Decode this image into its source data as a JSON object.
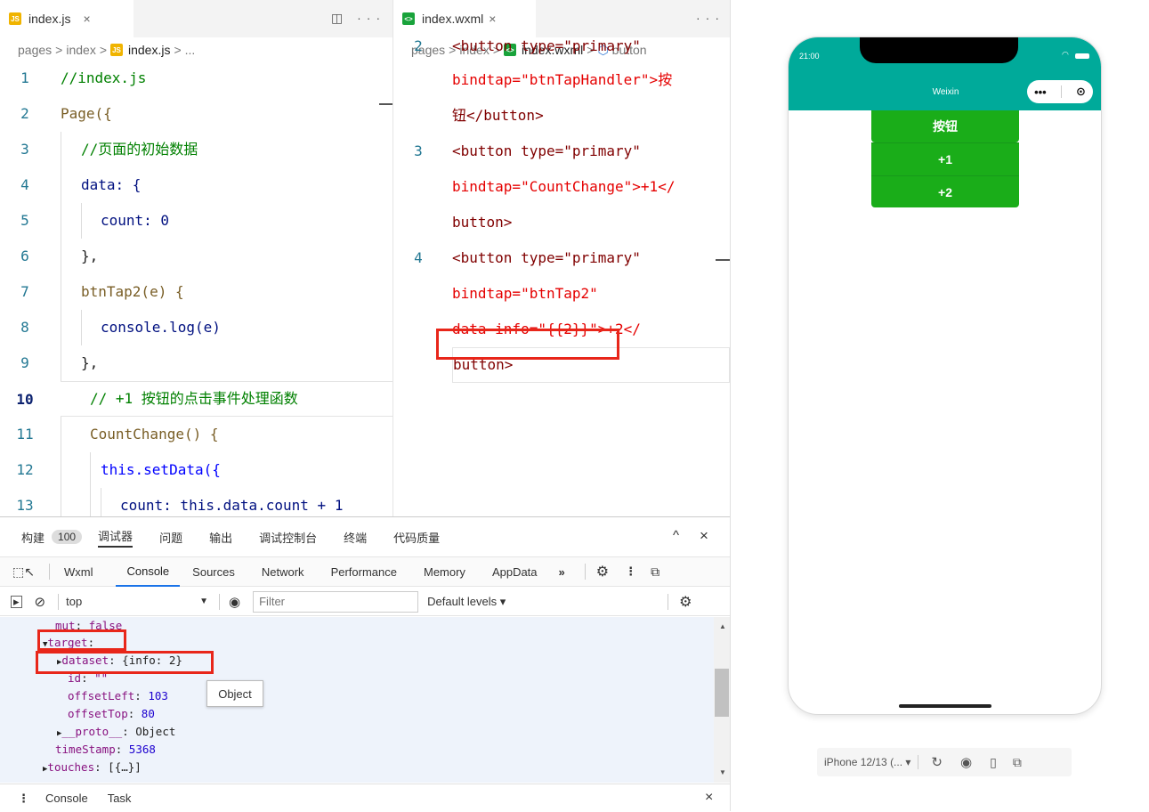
{
  "left_editor": {
    "tab_label": "index.js",
    "tab_close": "×",
    "tab_actions": "◫ ···",
    "breadcrumb": [
      "pages",
      ">",
      "index",
      ">",
      "index.js",
      ">",
      "..."
    ],
    "lines": [
      {
        "n": "1",
        "text": "//index.js"
      },
      {
        "n": "2",
        "text": "Page({"
      },
      {
        "n": "3",
        "text": "//页面的初始数据"
      },
      {
        "n": "4",
        "text": "data: {"
      },
      {
        "n": "5",
        "text": "count: 0"
      },
      {
        "n": "6",
        "text": "},"
      },
      {
        "n": "7",
        "text": "btnTap2(e) {"
      },
      {
        "n": "8",
        "text": "console.log(e)"
      },
      {
        "n": "9",
        "text": "},"
      },
      {
        "n": "10",
        "text": "// +1 按钮的点击事件处理函数"
      },
      {
        "n": "11",
        "text": "CountChange() {"
      },
      {
        "n": "12",
        "text": "this.setData({"
      },
      {
        "n": "13",
        "text": "count: this.data.count + 1"
      }
    ]
  },
  "right_editor": {
    "tab_label": "index.wxml",
    "tab_close": "×",
    "tab_actions": "···",
    "breadcrumb": [
      "pages",
      ">",
      "index",
      ">",
      "index.wxml",
      ">",
      "button"
    ],
    "lines": [
      {
        "n": "2",
        "text": "<button type=\"primary\""
      },
      {
        "n": "",
        "text": "bindtap=\"btnTapHandler\">按"
      },
      {
        "n": "",
        "text": "钮</button>"
      },
      {
        "n": "3",
        "text": "<button type=\"primary\""
      },
      {
        "n": "",
        "text": "bindtap=\"CountChange\">+1</"
      },
      {
        "n": "",
        "text": "button>"
      },
      {
        "n": "4",
        "text": "<button type=\"primary\""
      },
      {
        "n": "",
        "text": "bindtap=\"btnTap2\""
      },
      {
        "n": "",
        "text": "data-info=\"{{2}}\">+2</"
      },
      {
        "n": "",
        "text": "button>"
      }
    ]
  },
  "devtools": {
    "top_tabs": [
      "构建",
      "100",
      "调试器",
      "问题",
      "输出",
      "调试控制台",
      "终端",
      "代码质量"
    ],
    "top_controls": [
      "^",
      "×"
    ],
    "panel_tabs": [
      "Wxml",
      "Console",
      "Sources",
      "Network",
      "Performance",
      "Memory",
      "AppData",
      "»"
    ],
    "active_panel": "Console",
    "context": "top",
    "filter_placeholder": "Filter",
    "levels": "Default levels ▾",
    "console_lines": [
      {
        "indent": 0,
        "arrow": "",
        "key": "mut",
        "value": "false"
      },
      {
        "indent": 0,
        "arrow": "▼",
        "key": "target",
        "value": ""
      },
      {
        "indent": 1,
        "arrow": "▶",
        "key": "dataset",
        "value": "{info: 2}"
      },
      {
        "indent": 1,
        "arrow": "",
        "key": "id",
        "value": "\"\""
      },
      {
        "indent": 1,
        "arrow": "",
        "key": "offsetLeft",
        "value": "103"
      },
      {
        "indent": 1,
        "arrow": "",
        "key": "offsetTop",
        "value": "80"
      },
      {
        "indent": 1,
        "arrow": "▶",
        "key": "__proto__",
        "value": "Object"
      },
      {
        "indent": 0,
        "arrow": "",
        "key": "timeStamp",
        "value": "5368"
      },
      {
        "indent": 0,
        "arrow": "▶",
        "key": "touches",
        "value": "[{…}]"
      }
    ],
    "tooltip": "Object",
    "drawer_tabs": [
      "Console",
      "Task"
    ],
    "drawer_close": "×"
  },
  "simulator": {
    "time": "21:00",
    "nav_title": "Weixin",
    "buttons": [
      "按钮",
      "+1",
      "+2"
    ],
    "device": "iPhone 12/13 (... ▾",
    "colors": {
      "nav": "#00aa9a",
      "button": "#1aad19"
    }
  }
}
